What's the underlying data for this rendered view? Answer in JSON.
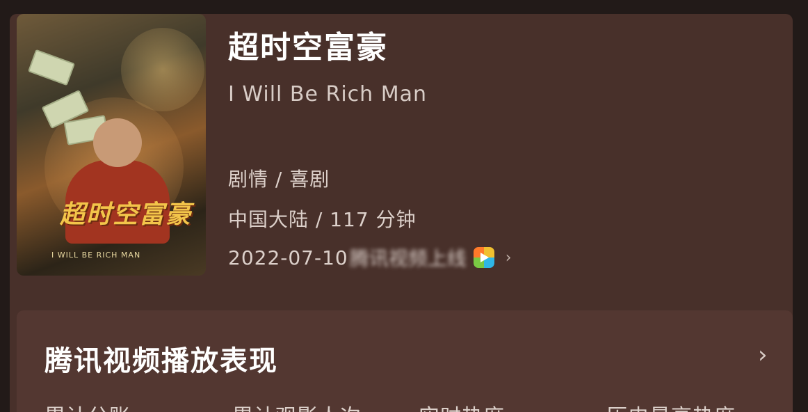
{
  "movie": {
    "title_cn": "超时空富豪",
    "title_en": "I Will Be Rich Man",
    "genres": "剧情 / 喜剧",
    "region_runtime": "中国大陆 / 117 分钟",
    "release_date": "2022-07-10",
    "release_platform_blurred": "腾讯视频上线",
    "platform_icon": "tencent-video-icon",
    "poster": {
      "art_title": "超时空富豪",
      "art_subtitle": "I WILL BE RICH MAN"
    }
  },
  "panel": {
    "title": "腾讯视频播放表现",
    "stats": [
      "累计分账",
      "累计观影人次",
      "实时热度",
      "历史最高热度"
    ]
  }
}
